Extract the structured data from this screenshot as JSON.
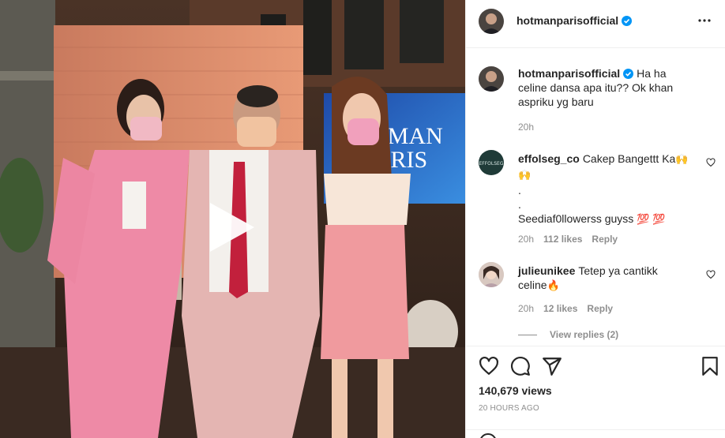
{
  "post": {
    "username": "hotmanparisofficial",
    "verified": true,
    "caption": "Ha ha celine dansa apa itu?? Ok khan aspriku yg baru",
    "caption_time": "20h",
    "views": "140,679 views",
    "time_ago": "20 HOURS AGO"
  },
  "video": {
    "tv_title_line1": "HOTMAN",
    "tv_title_line2": "PARIS"
  },
  "comments": [
    {
      "username": "effolseg_co",
      "text_line1": "Cakep Bangettt Ka",
      "emoji1": "🙌",
      "emoji2": "🙌",
      "dot1": ".",
      "dot2": ".",
      "text_line2": "Seediaf0llowerss guyss",
      "emoji3": "💯",
      "emoji4": "💯",
      "time": "20h",
      "likes": "112 likes",
      "reply": "Reply"
    },
    {
      "username": "julieunikee",
      "text": "Tetep ya cantikk",
      "text2": "celine",
      "emoji": "🔥",
      "time": "20h",
      "likes": "12 likes",
      "reply": "Reply",
      "view_replies": "View replies (2)"
    }
  ],
  "colors": {
    "verified": "#0095f6",
    "secondary_text": "#8e8e8e",
    "primary_text": "#262626"
  },
  "icons": [
    "more-icon",
    "heart-icon",
    "comment-icon",
    "share-icon",
    "bookmark-icon",
    "play-icon",
    "verified-icon"
  ]
}
